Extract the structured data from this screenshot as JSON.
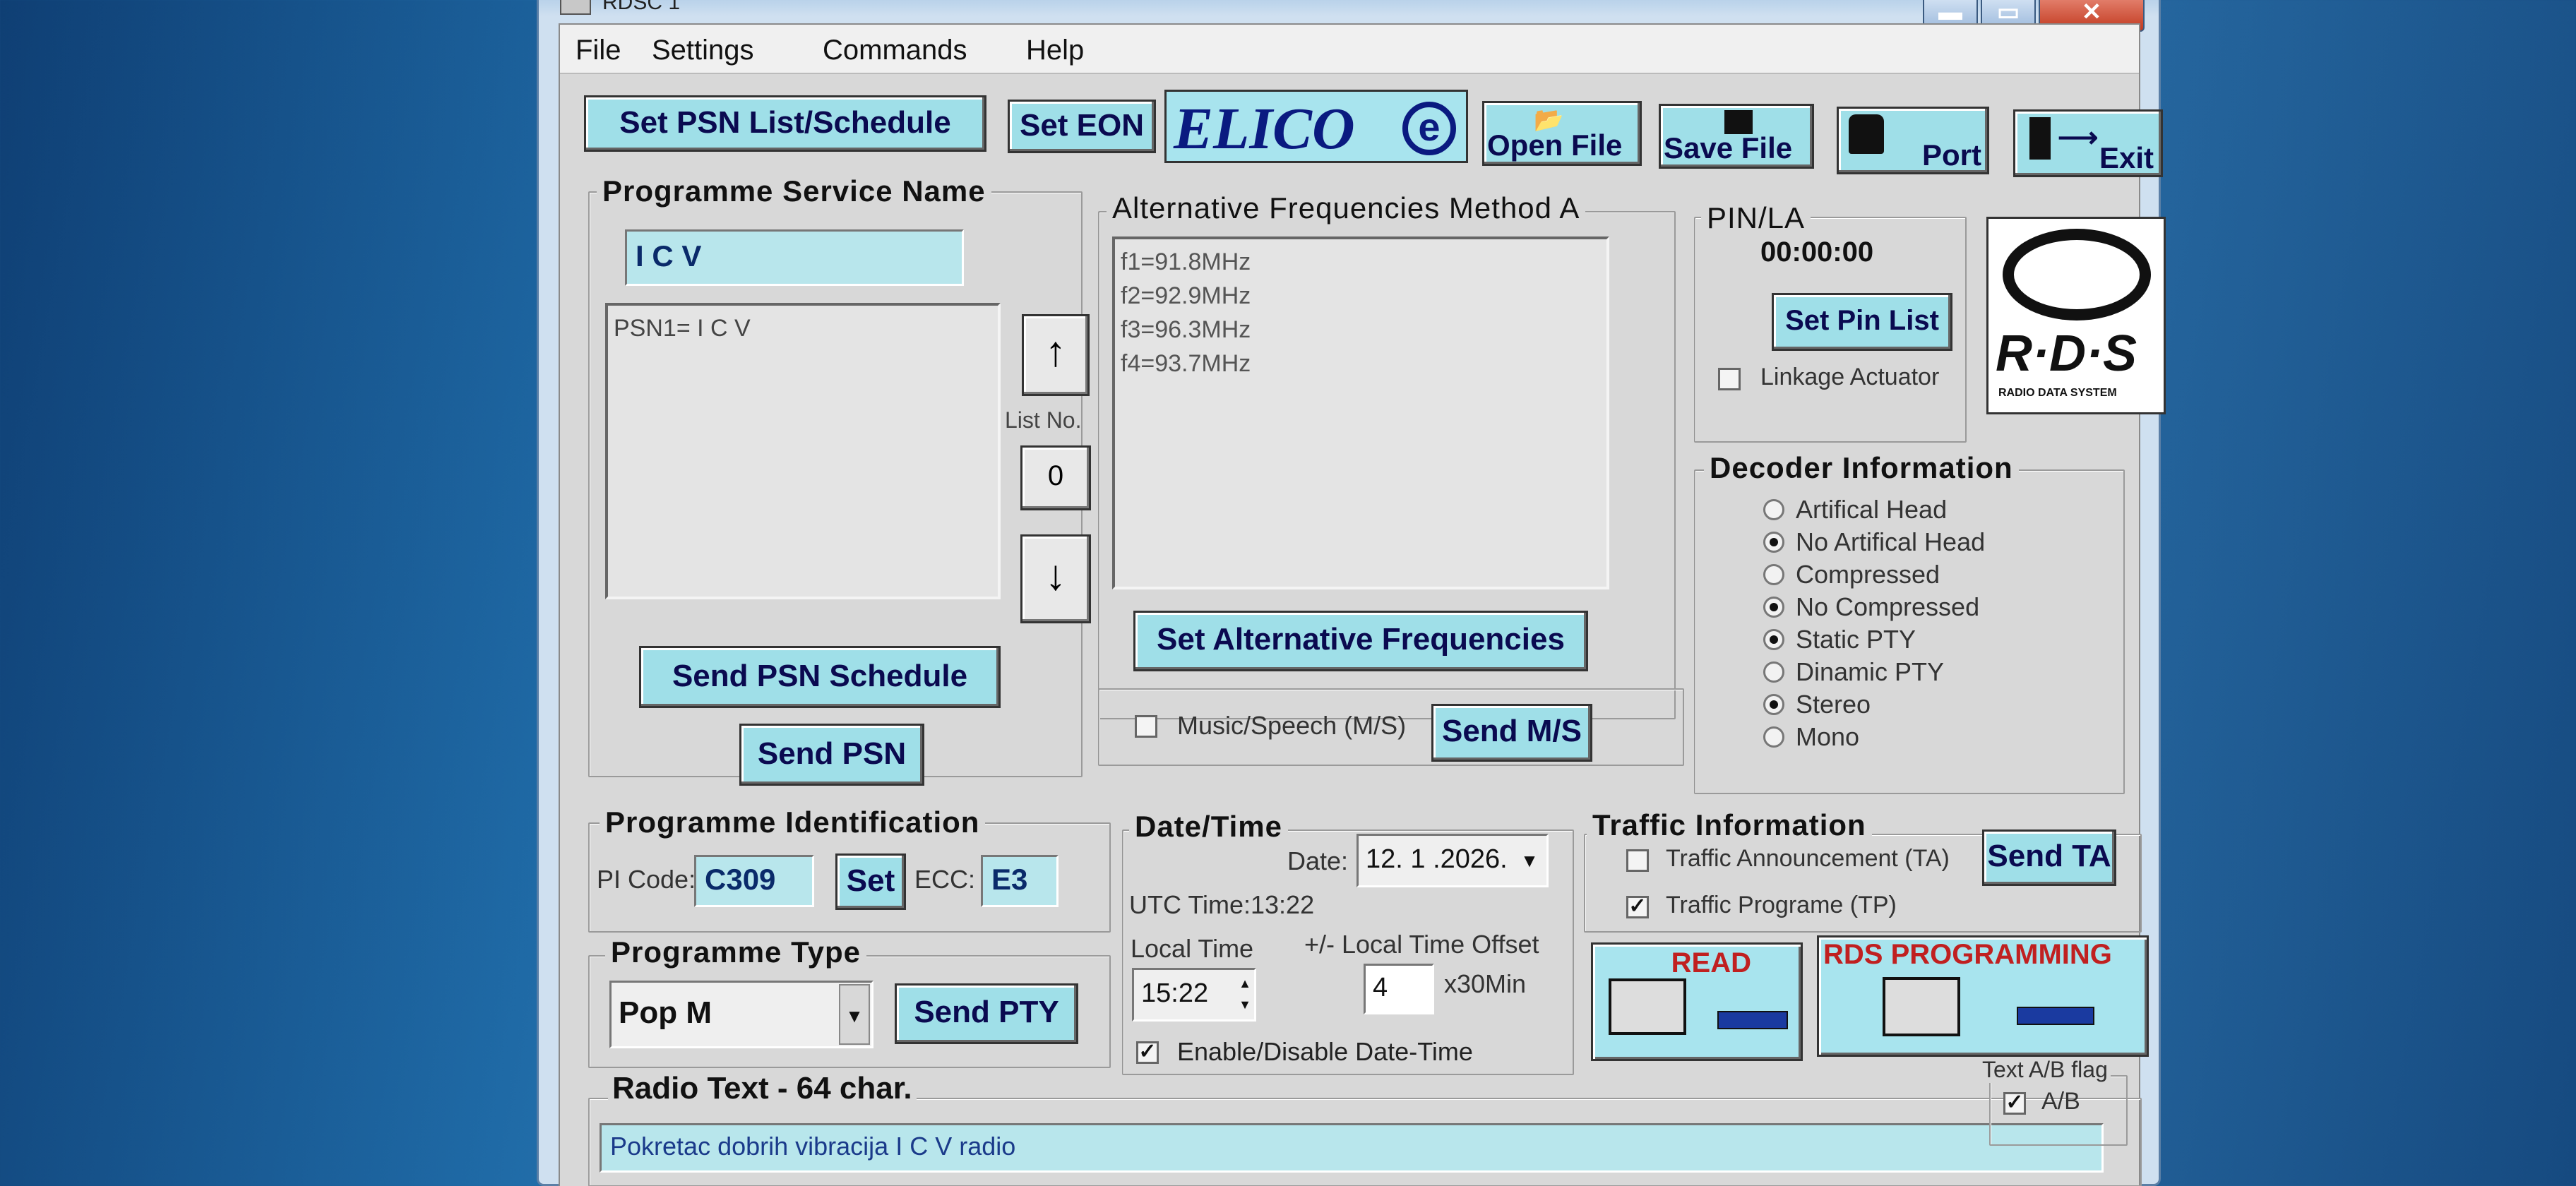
{
  "window": {
    "title": "RDSC 1"
  },
  "menu": [
    "File",
    "Settings",
    "Commands",
    "Help"
  ],
  "toolbar": {
    "set_psn_list": "Set PSN List/Schedule",
    "set_eon": "Set EON",
    "logo_text": "ELICO",
    "open_file": "Open File",
    "save_file": "Save File",
    "port": "Port",
    "exit": "Exit"
  },
  "psn": {
    "title": "Programme Service Name",
    "value": "I C V",
    "list": [
      "PSN1= I C V"
    ],
    "list_no_label": "List No.",
    "list_no": "0",
    "up": "↑",
    "down": "↓",
    "send_schedule": "Send PSN Schedule",
    "send": "Send PSN"
  },
  "af": {
    "title": "Alternative Frequencies Method A",
    "items": [
      "f1=91.8MHz",
      "f2=92.9MHz",
      "f3=96.3MHz",
      "f4=93.7MHz"
    ],
    "set_button": "Set Alternative Frequencies",
    "ms_label": "Music/Speech (M/S)",
    "ms_checked": false,
    "send_ms": "Send M/S"
  },
  "pin": {
    "title": "PIN/LA",
    "time": "00:00:00",
    "set_button": "Set Pin List",
    "linkage_label": "Linkage Actuator",
    "linkage_checked": false
  },
  "rds_logo": {
    "text": "R·D·S",
    "sub": "RADIO DATA SYSTEM"
  },
  "decoder": {
    "title": "Decoder Information",
    "options": [
      {
        "label": "Artifical Head",
        "on": false
      },
      {
        "label": "No Artifical Head",
        "on": true
      },
      {
        "label": "Compressed",
        "on": false
      },
      {
        "label": "No Compressed",
        "on": true
      },
      {
        "label": "Static PTY",
        "on": true
      },
      {
        "label": "Dinamic PTY",
        "on": false
      },
      {
        "label": "Stereo",
        "on": true
      },
      {
        "label": "Mono",
        "on": false
      }
    ]
  },
  "pi": {
    "title": "Programme Identification",
    "code_label": "PI Code:",
    "code": "C309",
    "set": "Set",
    "ecc_label": "ECC:",
    "ecc": "E3"
  },
  "pty": {
    "title": "Programme Type",
    "value": "Pop M",
    "send": "Send PTY"
  },
  "datetime": {
    "title": "Date/Time",
    "date_label": "Date:",
    "date": "12. 1 .2026.",
    "utc": "UTC Time:13:22",
    "local_label": "Local Time",
    "local_value": "15:22",
    "offset_label": "+/- Local Time Offset",
    "offset_value": "4",
    "offset_unit": "x30Min",
    "enable_label": "Enable/Disable Date-Time",
    "enable_checked": true
  },
  "traffic": {
    "title": "Traffic Information",
    "ta_label": "Traffic Announcement (TA)",
    "ta_checked": false,
    "send_ta": "Send TA",
    "tp_label": "Traffic Programe (TP)",
    "tp_checked": true
  },
  "read_panel": {
    "label": "READ"
  },
  "prog_panel": {
    "label": "RDS PROGRAMMING"
  },
  "radiotext": {
    "title": "Radio Text - 64 char.",
    "value": "Pokretac dobrih vibracija I C V radio",
    "ab_title": "Text A/B flag",
    "ab_label": "A/B",
    "ab_checked": true
  }
}
